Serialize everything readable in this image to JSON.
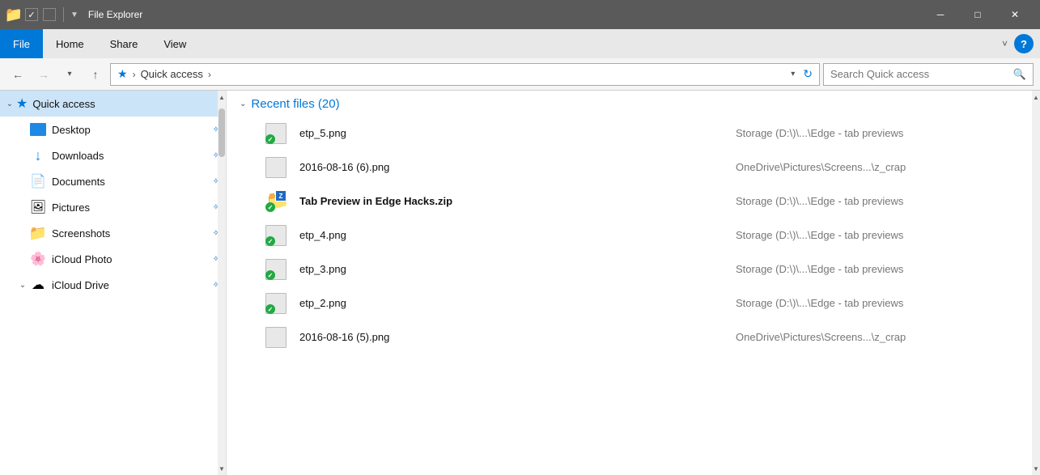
{
  "titleBar": {
    "title": "File Explorer",
    "minimize": "─",
    "maximize": "□",
    "close": "✕"
  },
  "menuBar": {
    "items": [
      {
        "label": "File",
        "active": true
      },
      {
        "label": "Home",
        "active": false
      },
      {
        "label": "Share",
        "active": false
      },
      {
        "label": "View",
        "active": false
      }
    ],
    "helpLabel": "?"
  },
  "addressBar": {
    "backDisabled": false,
    "forwardDisabled": true,
    "upDisabled": false,
    "pathParts": [
      "Quick access"
    ],
    "dropdownArrow": "▾",
    "refreshLabel": "↻",
    "searchPlaceholder": "Search Quick access"
  },
  "sidebar": {
    "items": [
      {
        "id": "quick-access",
        "label": "Quick access",
        "type": "header",
        "expanded": true
      },
      {
        "id": "desktop",
        "label": "Desktop",
        "type": "item",
        "pinned": true
      },
      {
        "id": "downloads",
        "label": "Downloads",
        "type": "item",
        "pinned": true
      },
      {
        "id": "documents",
        "label": "Documents",
        "type": "item",
        "pinned": true
      },
      {
        "id": "pictures",
        "label": "Pictures",
        "type": "item",
        "pinned": true
      },
      {
        "id": "screenshots",
        "label": "Screenshots",
        "type": "item",
        "pinned": true
      },
      {
        "id": "icloud-photo",
        "label": "iCloud Photo",
        "type": "item",
        "pinned": true
      },
      {
        "id": "icloud-drive",
        "label": "iCloud Drive",
        "type": "item",
        "pinned": true
      }
    ]
  },
  "fileList": {
    "sectionTitle": "Recent files (20)",
    "files": [
      {
        "name": "etp_5.png",
        "location": "Storage (D:\\)\\...\\Edge - tab previews",
        "type": "png-check",
        "bold": false
      },
      {
        "name": "2016-08-16 (6).png",
        "location": "OneDrive\\Pictures\\Screens...\\z_crap",
        "type": "png-plain",
        "bold": false
      },
      {
        "name": "Tab Preview in Edge Hacks.zip",
        "location": "Storage (D:\\)\\...\\Edge - tab previews",
        "type": "zip",
        "bold": true
      },
      {
        "name": "etp_4.png",
        "location": "Storage (D:\\)\\...\\Edge - tab previews",
        "type": "png-check",
        "bold": false
      },
      {
        "name": "etp_3.png",
        "location": "Storage (D:\\)\\...\\Edge - tab previews",
        "type": "png-check",
        "bold": false
      },
      {
        "name": "etp_2.png",
        "location": "Storage (D:\\)\\...\\Edge - tab previews",
        "type": "png-check",
        "bold": false
      },
      {
        "name": "2016-08-16 (5).png",
        "location": "OneDrive\\Pictures\\Screens...\\z_crap",
        "type": "png-plain",
        "bold": false
      }
    ]
  }
}
